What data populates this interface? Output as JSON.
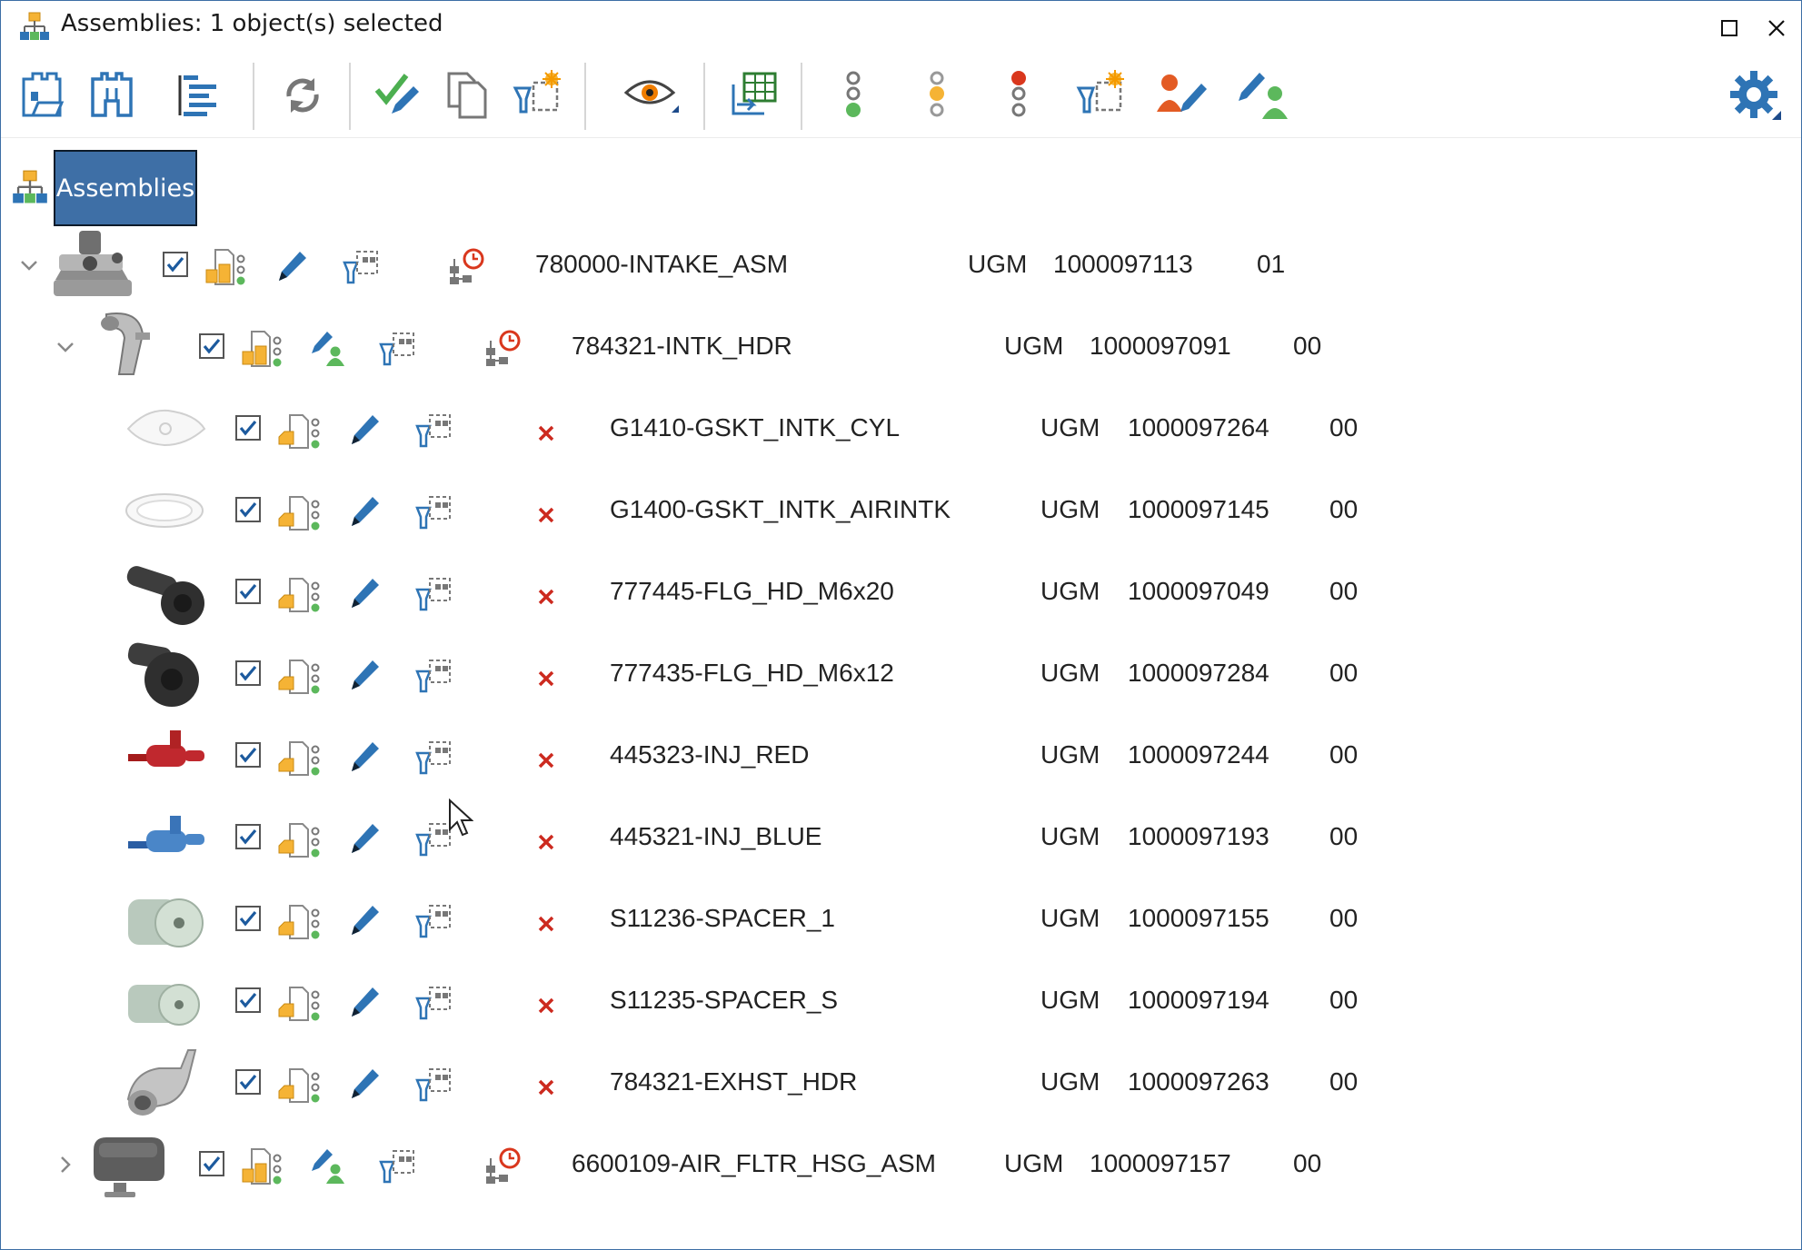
{
  "window": {
    "title": "Assemblies: 1 object(s) selected",
    "maximize_glyph": "☐",
    "close_glyph": "✕"
  },
  "toolbar": {
    "buttons": [
      {
        "name": "open-assembly-icon"
      },
      {
        "name": "binoculars-icon"
      },
      {
        "name": "tree-view-icon"
      },
      {
        "name": "refresh-icon"
      },
      {
        "name": "check-edit-icon"
      },
      {
        "name": "copy-icon"
      },
      {
        "name": "new-variant-icon"
      },
      {
        "name": "view-eye-icon"
      },
      {
        "name": "export-table-icon"
      },
      {
        "name": "status-green-icon"
      },
      {
        "name": "status-yellow-icon"
      },
      {
        "name": "status-red-icon"
      },
      {
        "name": "new-config-icon"
      },
      {
        "name": "user-edit-red-icon"
      },
      {
        "name": "user-edit-green-icon"
      },
      {
        "name": "settings-gear-icon"
      }
    ]
  },
  "breadcrumb": {
    "label": "Assemblies"
  },
  "tree": {
    "rows": [
      {
        "level": 0,
        "expanded": true,
        "name": "780000-INTAKE_ASM",
        "type": "UGM",
        "id": "1000097113",
        "rev": "01",
        "thumb": "intake-assembly",
        "status": "clock"
      },
      {
        "level": 1,
        "expanded": true,
        "name": "784321-INTK_HDR",
        "type": "UGM",
        "id": "1000097091",
        "rev": "00",
        "thumb": "intake-header",
        "status": "clock"
      },
      {
        "level": 2,
        "name": "G1410-GSKT_INTK_CYL",
        "type": "UGM",
        "id": "1000097264",
        "rev": "00",
        "thumb": "gasket-square",
        "status": "x"
      },
      {
        "level": 2,
        "name": "G1400-GSKT_INTK_AIRINTK",
        "type": "UGM",
        "id": "1000097145",
        "rev": "00",
        "thumb": "gasket-round",
        "status": "x"
      },
      {
        "level": 2,
        "name": "777445-FLG_HD_M6x20",
        "type": "UGM",
        "id": "1000097049",
        "rev": "00",
        "thumb": "bolt",
        "status": "x"
      },
      {
        "level": 2,
        "name": "777435-FLG_HD_M6x12",
        "type": "UGM",
        "id": "1000097284",
        "rev": "00",
        "thumb": "bolt-short",
        "status": "x"
      },
      {
        "level": 2,
        "name": "445323-INJ_RED",
        "type": "UGM",
        "id": "1000097244",
        "rev": "00",
        "thumb": "injector-red",
        "status": "x"
      },
      {
        "level": 2,
        "name": "445321-INJ_BLUE",
        "type": "UGM",
        "id": "1000097193",
        "rev": "00",
        "thumb": "injector-blue",
        "status": "x"
      },
      {
        "level": 2,
        "name": "S11236-SPACER_1",
        "type": "UGM",
        "id": "1000097155",
        "rev": "00",
        "thumb": "spacer-large",
        "status": "x"
      },
      {
        "level": 2,
        "name": "S11235-SPACER_S",
        "type": "UGM",
        "id": "1000097194",
        "rev": "00",
        "thumb": "spacer-small",
        "status": "x"
      },
      {
        "level": 2,
        "name": "784321-EXHST_HDR",
        "type": "UGM",
        "id": "1000097263",
        "rev": "00",
        "thumb": "exhaust-header",
        "status": "x"
      },
      {
        "level": 1,
        "expanded": false,
        "name": "6600109-AIR_FLTR_HSG_ASM",
        "type": "UGM",
        "id": "1000097157",
        "rev": "00",
        "thumb": "air-filter-housing",
        "status": "clock"
      }
    ]
  },
  "colors": {
    "accent": "#3e6fa6",
    "icon_blue": "#2e74b5",
    "yellow": "#f5b335",
    "green": "#5cb85c",
    "red": "#cc2a1f"
  }
}
